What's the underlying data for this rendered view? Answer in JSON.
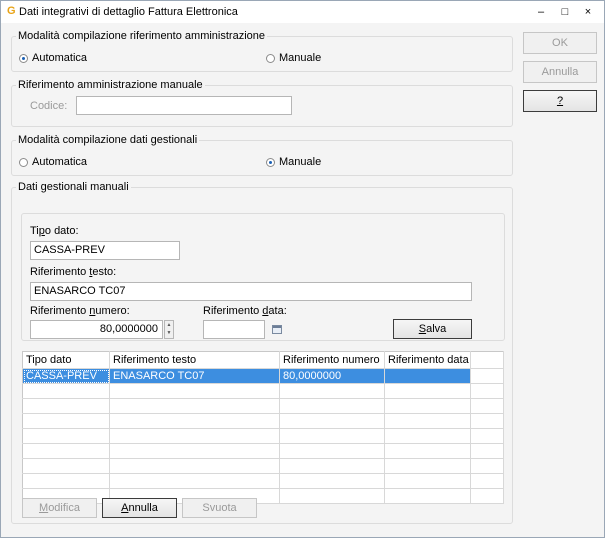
{
  "window": {
    "title": "Dati integrativi di dettaglio Fattura Elettronica",
    "app_icon": "G",
    "minimize": "–",
    "maximize": "□",
    "close": "×"
  },
  "amministrazione": {
    "legend": "Modalità compilazione riferimento amministrazione",
    "automatica_label": "Automatica",
    "manuale_label": "Manuale",
    "selected": "automatica"
  },
  "riferimento_manuale": {
    "legend": "Riferimento amministrazione manuale",
    "codice_label": "Codice:",
    "codice_value": ""
  },
  "gestionali": {
    "legend": "Modalità compilazione dati gestionali",
    "automatica_label": "Automatica",
    "manuale_label": "Manuale",
    "selected": "manuale"
  },
  "dati_manuali": {
    "legend": "Dati gestionali manuali",
    "tipo_dato_label_pre": "Ti",
    "tipo_dato_label_u": "p",
    "tipo_dato_label_post": "o dato:",
    "tipo_dato_value": "CASSA-PREV",
    "rif_testo_label_pre": "Riferimento ",
    "rif_testo_label_u": "t",
    "rif_testo_label_post": "esto:",
    "rif_testo_value": "ENASARCO TC07",
    "rif_numero_label_pre": "Riferimento ",
    "rif_numero_label_u": "n",
    "rif_numero_label_post": "umero:",
    "rif_numero_value": "80,0000000",
    "rif_data_label_pre": "Riferimento ",
    "rif_data_label_u": "d",
    "rif_data_label_post": "ata:",
    "rif_data_value": "",
    "salva_pre": "",
    "salva_u": "S",
    "salva_post": "alva"
  },
  "grid": {
    "columns": [
      "Tipo dato",
      "Riferimento testo",
      "Riferimento numero",
      "Riferimento data"
    ],
    "rows": [
      [
        "CASSA-PREV",
        "ENASARCO TC07",
        "80,0000000",
        ""
      ]
    ]
  },
  "bottom_buttons": {
    "modifica_u": "M",
    "modifica_post": "odifica",
    "annulla_u": "A",
    "annulla_post": "nnulla",
    "svuota": "Svuota"
  },
  "side_buttons": {
    "ok": "OK",
    "annulla": "Annulla",
    "help": "?"
  }
}
